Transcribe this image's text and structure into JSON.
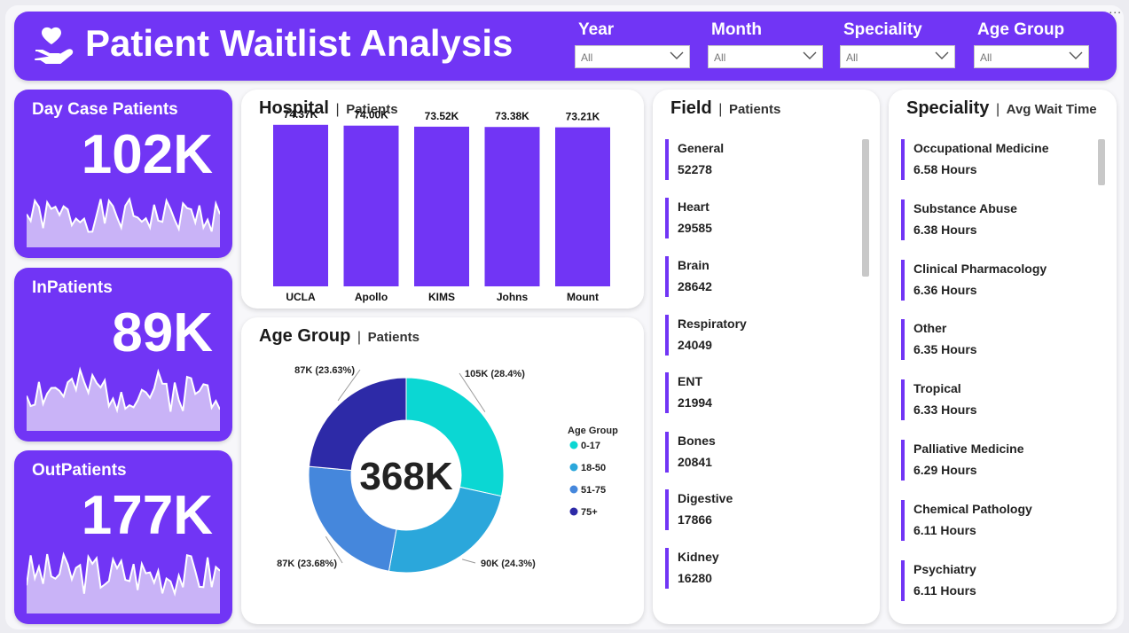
{
  "header": {
    "title": "Patient Waitlist Analysis",
    "filters": [
      {
        "label": "Year",
        "value": "All"
      },
      {
        "label": "Month",
        "value": "All"
      },
      {
        "label": "Speciality",
        "value": "All"
      },
      {
        "label": "Age Group",
        "value": "All"
      }
    ]
  },
  "more_label": "...",
  "kpis": [
    {
      "label": "Day Case Patients",
      "value": "102K"
    },
    {
      "label": "InPatients",
      "value": "89K"
    },
    {
      "label": "OutPatients",
      "value": "177K"
    }
  ],
  "hospital": {
    "title": "Hospital",
    "subtitle": "Patients"
  },
  "age_group": {
    "title": "Age Group",
    "subtitle": "Patients",
    "center": "368K",
    "legend_title": "Age Group"
  },
  "field": {
    "title": "Field",
    "subtitle": "Patients",
    "items": [
      {
        "name": "General",
        "value": "52278"
      },
      {
        "name": "Heart",
        "value": "29585"
      },
      {
        "name": "Brain",
        "value": "28642"
      },
      {
        "name": "Respiratory",
        "value": "24049"
      },
      {
        "name": "ENT",
        "value": "21994"
      },
      {
        "name": "Bones",
        "value": "20841"
      },
      {
        "name": "Digestive",
        "value": "17866"
      },
      {
        "name": "Kidney",
        "value": "16280"
      }
    ]
  },
  "speciality": {
    "title": "Speciality",
    "subtitle": "Avg Wait Time",
    "items": [
      {
        "name": "Occupational Medicine",
        "value": "6.58 Hours"
      },
      {
        "name": "Substance Abuse",
        "value": "6.38 Hours"
      },
      {
        "name": "Clinical Pharmacology",
        "value": "6.36 Hours"
      },
      {
        "name": "Other",
        "value": "6.35 Hours"
      },
      {
        "name": "Tropical",
        "value": "6.33 Hours"
      },
      {
        "name": "Palliative Medicine",
        "value": "6.29 Hours"
      },
      {
        "name": "Chemical Pathology",
        "value": "6.11 Hours"
      },
      {
        "name": "Psychiatry",
        "value": "6.11 Hours"
      }
    ]
  },
  "colors": {
    "accent": "#7135f5",
    "donut": [
      "#0bd7d3",
      "#2ba7db",
      "#4587dc",
      "#2d2aa7"
    ]
  },
  "chart_data": [
    {
      "type": "bar",
      "categories": [
        "UCLA",
        "Apollo",
        "KIMS",
        "Johns",
        "Mount"
      ],
      "values": [
        74.37,
        74.0,
        73.52,
        73.38,
        73.21
      ],
      "labels": [
        "74.37K",
        "74.00K",
        "73.52K",
        "73.38K",
        "73.21K"
      ],
      "ylim": [
        0,
        80
      ]
    },
    {
      "type": "pie",
      "categories": [
        "0-17",
        "18-50",
        "51-75",
        "75+"
      ],
      "values": [
        105,
        90,
        87,
        87
      ],
      "labels": [
        "105K (28.4%)",
        "90K (24.3%)",
        "87K (23.68%)",
        "87K (23.63%)"
      ]
    }
  ]
}
